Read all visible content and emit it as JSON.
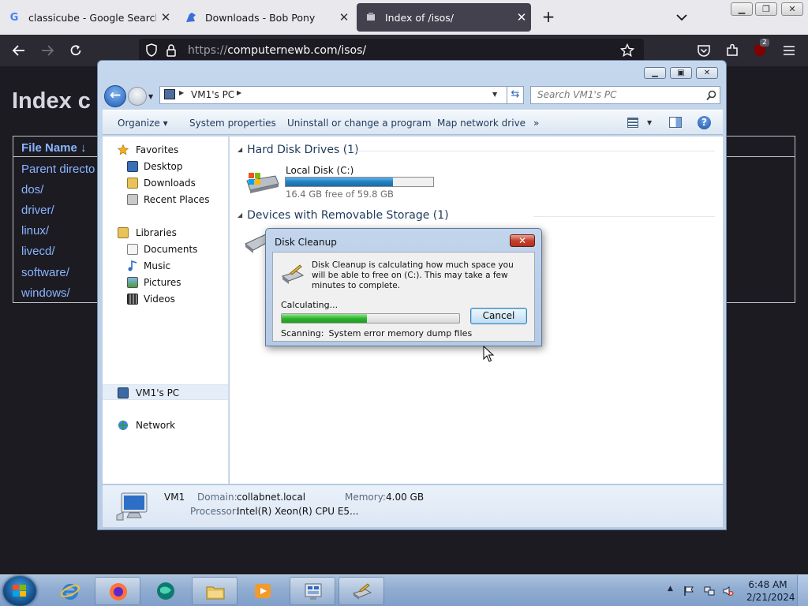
{
  "browser": {
    "tabs": [
      {
        "title": "classicube - Google Search",
        "icon": "google-icon",
        "active": false
      },
      {
        "title": "Downloads - Bob Pony",
        "icon": "pony-icon",
        "active": false
      },
      {
        "title": "Index of /isos/",
        "icon": "page-icon",
        "active": true
      }
    ],
    "new_tab": "+",
    "url_protocol": "https://",
    "url_host": "computernewb.com/isos/",
    "extension_badge": "2"
  },
  "page": {
    "heading": "Index c",
    "table_header": "File Name  ↓",
    "links": [
      "Parent directo",
      "dos/",
      "driver/",
      "linux/",
      "livecd/",
      "software/",
      "windows/"
    ]
  },
  "explorer": {
    "address_label": "VM1's PC",
    "search_placeholder": "Search VM1's PC",
    "commands": [
      "Organize ▾",
      "System properties",
      "Uninstall or change a program",
      "Map network drive",
      "»"
    ],
    "nav": {
      "favorites": "Favorites",
      "favorites_items": [
        "Desktop",
        "Downloads",
        "Recent Places"
      ],
      "libraries": "Libraries",
      "libraries_items": [
        "Documents",
        "Music",
        "Pictures",
        "Videos"
      ],
      "computer": "VM1's PC",
      "network": "Network"
    },
    "groups": {
      "hard_disks": "Hard Disk Drives (1)",
      "removable": "Devices with Removable Storage (1)"
    },
    "drive": {
      "name": "Local Disk (C:)",
      "free_text": "16.4 GB free of 59.8 GB",
      "used_fraction": 0.726
    },
    "details": {
      "computer_name": "VM1",
      "domain_label": "Domain:",
      "domain_value": "collabnet.local",
      "memory_label": "Memory:",
      "memory_value": "4.00 GB",
      "processor_label": "Processor:",
      "processor_value": "Intel(R) Xeon(R) CPU E5..."
    }
  },
  "dialog": {
    "title": "Disk Cleanup",
    "message": "Disk Cleanup is calculating how much space you will be able to free on  (C:). This may take a few minutes to complete.",
    "status": "Calculating...",
    "progress_fraction": 0.48,
    "cancel_label": "Cancel",
    "scanning_label": "Scanning:",
    "scanning_value": "System error memory dump files"
  },
  "taskbar": {
    "time": "6:48 AM",
    "date": "2/21/2024"
  },
  "colors": {
    "accent_link": "#8ab4ff",
    "progress_green": "#2db52d",
    "drive_bar_blue": "#1f7fc0"
  }
}
